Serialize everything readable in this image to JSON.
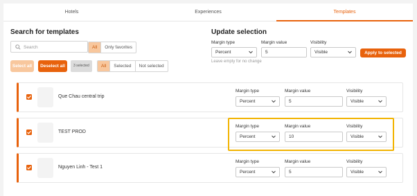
{
  "tabs": [
    {
      "label": "Hotels"
    },
    {
      "label": "Experiences"
    },
    {
      "label": "Templates"
    }
  ],
  "search_panel": {
    "title": "Search for templates",
    "search_placeholder": "Search",
    "filter_fav": [
      "All",
      "Only favorites"
    ],
    "select_all": "Select all",
    "deselect_all": "Deselect all",
    "selected_count": "3 selected",
    "filter_sel": [
      "All",
      "Selected",
      "Not selected"
    ]
  },
  "update_panel": {
    "title": "Update selection",
    "margin_type_label": "Margin type",
    "margin_type_value": "Percent",
    "margin_value_label": "Margin value",
    "margin_value": "5",
    "visibility_label": "Visibility",
    "visibility_value": "Visible",
    "apply_label": "Apply to selected",
    "hint": "Leave empty for no change"
  },
  "field_labels": {
    "margin_type": "Margin type",
    "margin_value": "Margin value",
    "visibility": "Visibility"
  },
  "templates": [
    {
      "name": "Que Chau central trip",
      "margin_type": "Percent",
      "margin_value": "5",
      "visibility": "Visible"
    },
    {
      "name": "TEST PROD",
      "margin_type": "Percent",
      "margin_value": "10",
      "visibility": "Visible"
    },
    {
      "name": "Nguyen Linh - Test 1",
      "margin_type": "Percent",
      "margin_value": "5",
      "visibility": "Visible"
    }
  ],
  "colors": {
    "accent": "#e8620c",
    "accent_light": "#f8c79d",
    "highlight": "#f2b300"
  }
}
